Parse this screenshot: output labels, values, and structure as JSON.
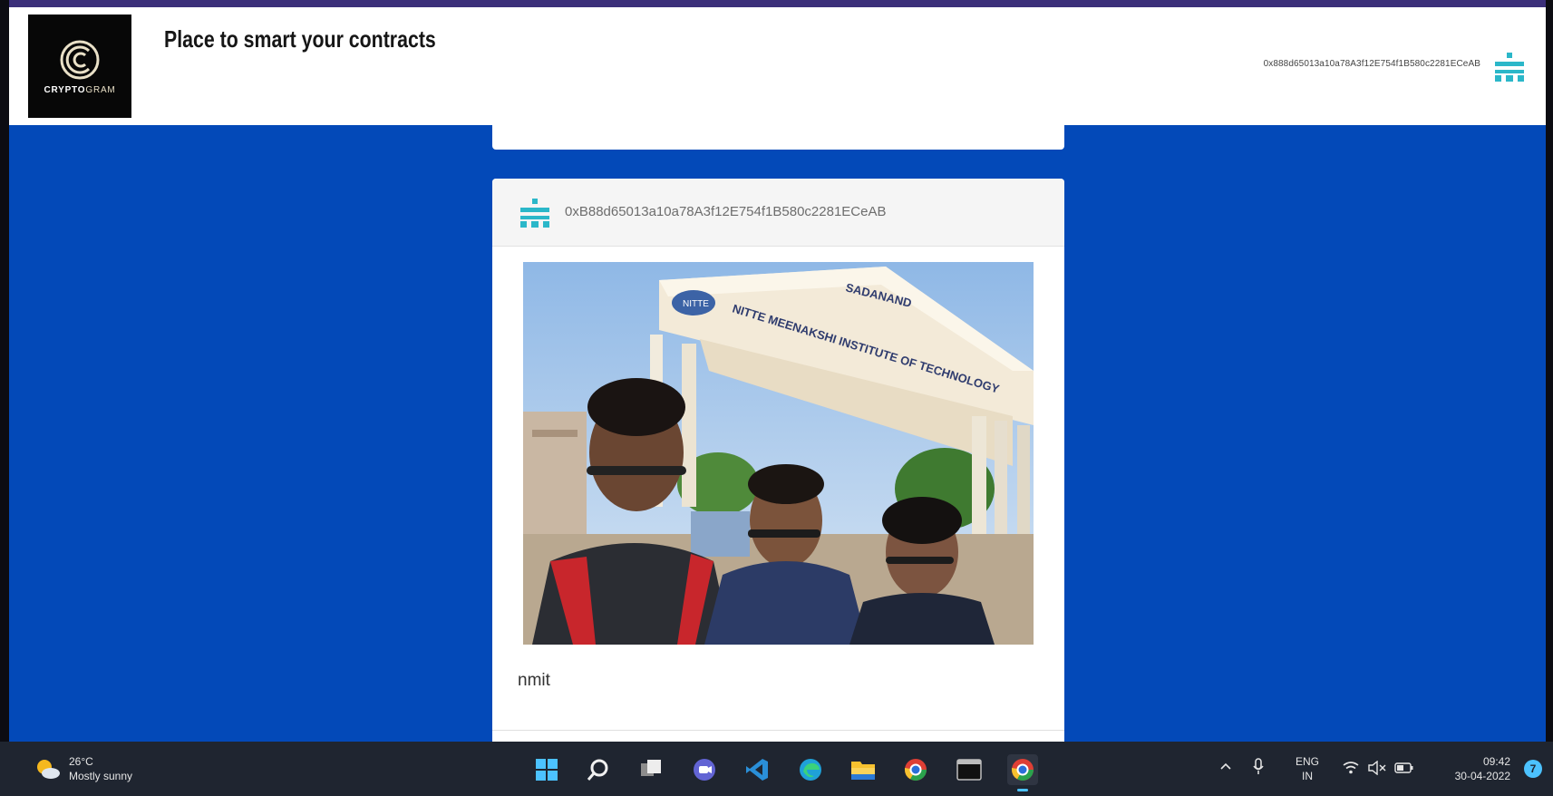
{
  "header": {
    "logo_text_bold": "CRYPTO",
    "logo_text_light": "GRAM",
    "tagline": "Place to smart your contracts",
    "account_address": "0x888d65013a10a78A3f12E754f1B580c2281ECeAB",
    "account_icon": "identicon-icon"
  },
  "feed": {
    "posts": [
      {
        "author_address": "0xB88d65013a10a78A3f12E754f1B580c2281ECeAB",
        "avatar_icon": "identicon-icon",
        "image_content": "selfie-photo",
        "image_sign_words": [
          "NITTE",
          "SADANAND",
          "NITTE MEENAKSHI INSTITUTE OF TECHNOLOGY"
        ],
        "caption": "nmit"
      }
    ]
  },
  "colors": {
    "page_background": "#0349b8",
    "navbar": "#ffffff",
    "identicon": "#2bb7c9",
    "taskbar": "#1f2530"
  },
  "taskbar": {
    "weather_temp": "26°C",
    "weather_desc": "Mostly sunny",
    "pinned_icons": [
      "start-icon",
      "search-icon",
      "task-view-icon",
      "teams-chat-icon",
      "vscode-icon",
      "edge-icon",
      "file-explorer-icon",
      "chrome-icon",
      "terminal-icon",
      "chrome-active-icon"
    ],
    "language_top": "ENG",
    "language_bottom": "IN",
    "time": "09:42",
    "date": "30-04-2022",
    "notification_count": "7"
  }
}
